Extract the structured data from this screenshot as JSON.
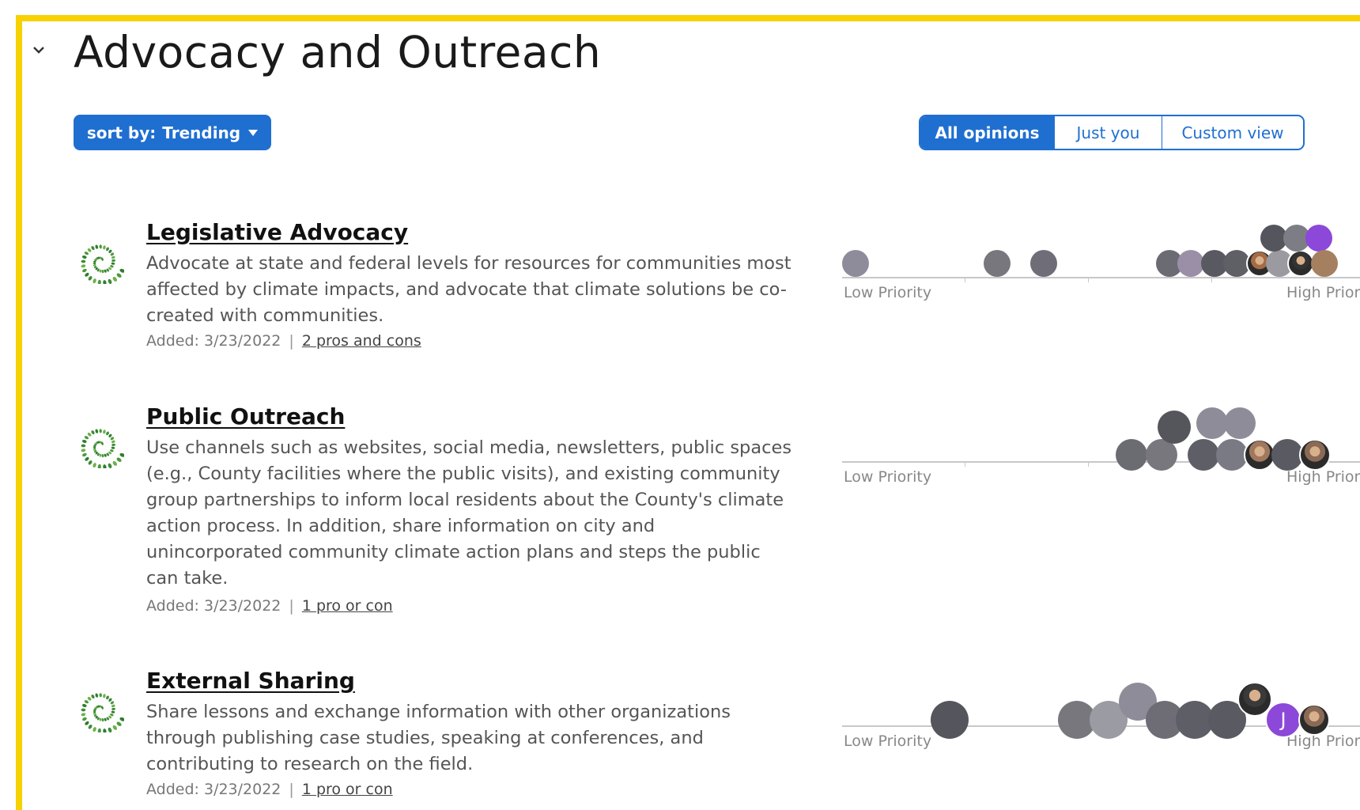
{
  "section": {
    "title": "Advocacy and Outreach"
  },
  "toolbar": {
    "sort_label": "sort by:",
    "sort_value": "Trending",
    "views": [
      "All opinions",
      "Just you",
      "Custom view"
    ],
    "active_view": "All opinions"
  },
  "colors": {
    "accent": "#1f6fd1",
    "frame": "#f7d100"
  },
  "items": [
    {
      "title": "Legislative Advocacy",
      "description": "Advocate at state and federal levels for resources for communities most affected by climate impacts, and advocate that climate solutions be co-created with communities.",
      "added": "Added: 3/23/2022",
      "pros_cons": "2 pros and cons",
      "scale_low": "Low Priority",
      "scale_high": "High Prior"
    },
    {
      "title": "Public Outreach",
      "description": "Use channels such as websites, social media, newsletters, public spaces (e.g., County facilities where the public visits), and existing community group partnerships to inform local residents about the County's climate action process. In addition, share information on city and unincorporated community climate action plans and steps the public can take.",
      "added": "Added: 3/23/2022",
      "pros_cons": "1 pro or con",
      "scale_low": "Low Priority",
      "scale_high": "High Prior"
    },
    {
      "title": "External Sharing",
      "description": "Share lessons and exchange information with other organizations through publishing case studies, speaking at conferences, and contributing to research on the field.",
      "added": "Added: 3/23/2022",
      "pros_cons": "1 pro or con",
      "scale_low": "Low Priority",
      "scale_high": "High Prior"
    }
  ],
  "avatar_initial": "J"
}
